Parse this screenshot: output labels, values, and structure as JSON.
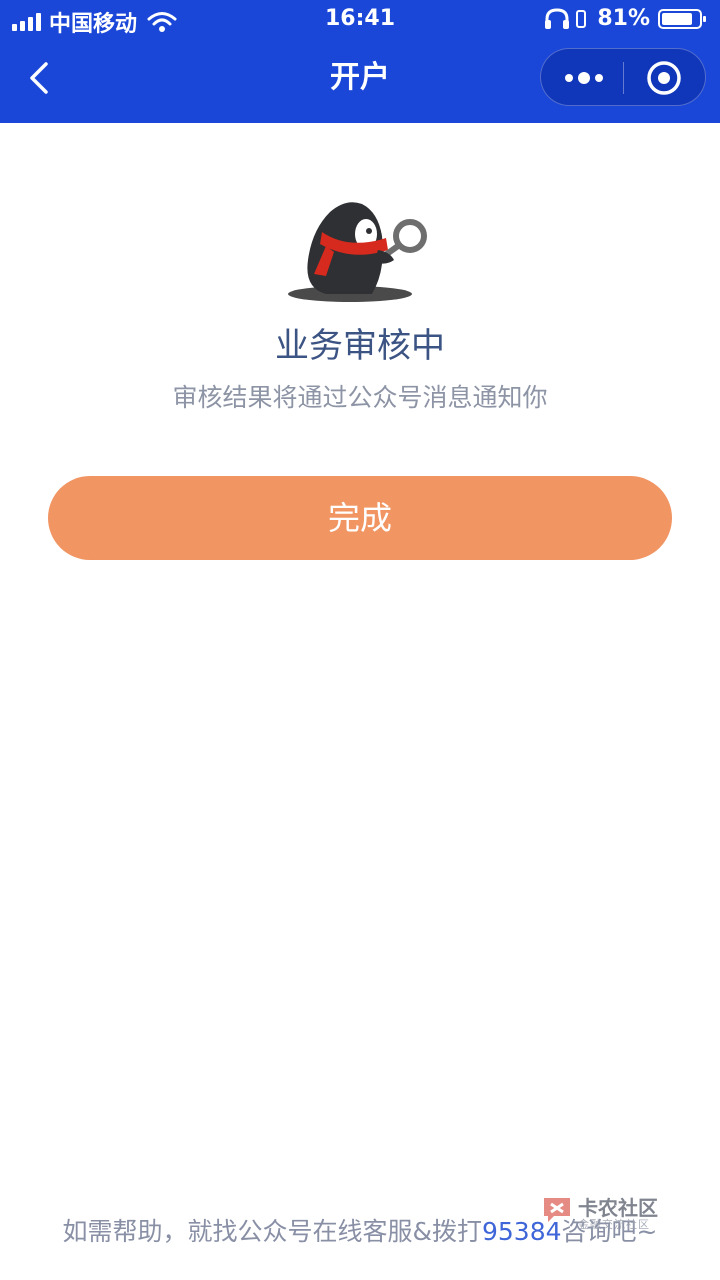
{
  "status_bar": {
    "carrier": "中国移动",
    "time": "16:41",
    "battery": "81%"
  },
  "nav": {
    "title": "开户"
  },
  "result": {
    "title": "业务审核中",
    "subtitle": "审核结果将通过公众号消息通知你"
  },
  "actions": {
    "done_label": "完成"
  },
  "footer": {
    "text_prefix": "如需帮助，就找公众号在线客服&拨打",
    "phone": "95384",
    "text_suffix": "咨询吧~"
  },
  "watermark": {
    "title": "卡农社区",
    "subtitle": "金融交流社区"
  },
  "colors": {
    "header": "#1a47d8",
    "button": "#f19563",
    "title_text": "#3c5484",
    "link": "#3f66d8"
  }
}
